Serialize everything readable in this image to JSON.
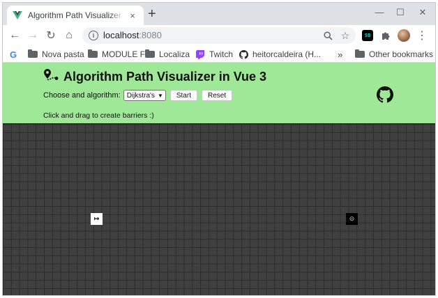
{
  "browser": {
    "tab": {
      "title": "Algorithm Path Visualizer in Vue 3",
      "close": "×"
    },
    "new_tab": "+",
    "window_controls": {
      "minimize": "—",
      "maximize": "☐",
      "close": "✕"
    },
    "nav": {
      "back": "←",
      "forward": "→",
      "reload": "↻",
      "home": "⌂"
    },
    "address": {
      "host": "localhost",
      "port": ":8080"
    },
    "menu": "⋮",
    "extension": "SB"
  },
  "bookmarks": {
    "items": [
      {
        "label": "Nova pasta",
        "icon": "folder-icon"
      },
      {
        "label": "MODULE F",
        "icon": "folder-icon"
      },
      {
        "label": "Localiza",
        "icon": "folder-icon"
      },
      {
        "label": "Twitch",
        "icon": "twitch-icon"
      },
      {
        "label": "heitorcaldeira (H...",
        "icon": "github-icon"
      }
    ],
    "overflow": "»",
    "other": "Other bookmarks"
  },
  "app": {
    "title": "Algorithm Path Visualizer in Vue 3",
    "choose_label": "Choose and algorithm:",
    "algorithm_selected": "Dijkstra's",
    "start_button": "Start",
    "reset_button": "Reset",
    "hint": "Click and drag to create barriers :)",
    "start_node_symbol": "↦",
    "end_node_symbol": "⊝"
  },
  "colors": {
    "header_bg": "#9ee897",
    "grid_bg": "#404040",
    "grid_line": "#2c2c2c",
    "start_node": "#ffffff",
    "end_node": "#000000"
  }
}
